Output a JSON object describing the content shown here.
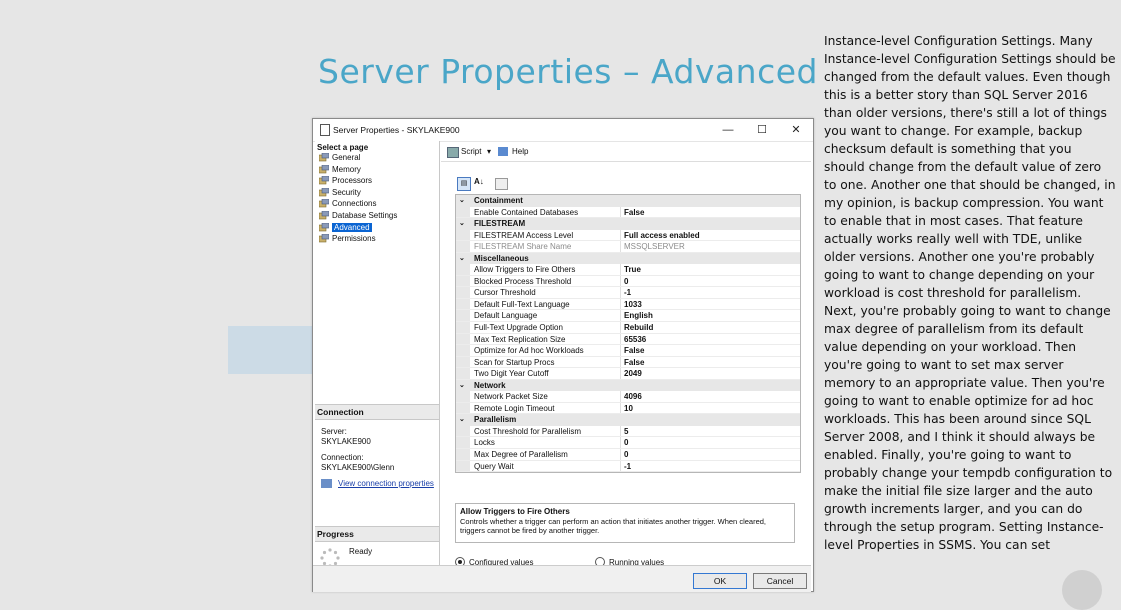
{
  "slide": {
    "title": "Server Properties – Advanced",
    "notes": "Instance-level Configuration Settings. Many Instance-level Configuration Settings should be changed from the default values. Even though this is a better story than SQL Server 2016 than older versions, there's still a lot of things you want to change. For example, backup checksum default is something that you should change from the default value of zero to one. Another one that should be changed, in my opinion, is backup compression. You want to enable that in most cases. That feature actually works really well with TDE, unlike older versions. Another one you're probably going to want to change depending on your workload is cost threshold for parallelism. Next, you're probably going to want to change max degree of parallelism from its default value depending on your workload. Then you're going to want to set max server memory to an appropriate value. Then you're going to want to enable optimize for ad hoc workloads. This has been around since SQL Server 2008, and I think it should always be enabled. Finally, you're going to want to probably change your tempdb configuration to make the initial file size larger and the auto growth increments larger, and you can do through the setup program. Setting Instance-level Properties in SSMS. You can set"
  },
  "dialog": {
    "title": "Server Properties - SKYLAKE900",
    "window_buttons": {
      "minimize": "—",
      "maximize": "☐",
      "close": "✕"
    },
    "select_page_header": "Select a page",
    "pages": [
      "General",
      "Memory",
      "Processors",
      "Security",
      "Connections",
      "Database Settings",
      "Advanced",
      "Permissions"
    ],
    "selected_page": "Advanced",
    "toolbar": {
      "script": "Script",
      "help": "Help"
    },
    "connection": {
      "header": "Connection",
      "server_label": "Server:",
      "server_value": "SKYLAKE900",
      "connection_label": "Connection:",
      "connection_value": "SKYLAKE900\\Glenn",
      "view_link": "View connection properties"
    },
    "progress": {
      "header": "Progress",
      "status": "Ready"
    },
    "grid": [
      {
        "type": "cat",
        "name": "Containment"
      },
      {
        "type": "prop",
        "name": "Enable Contained Databases",
        "value": "False"
      },
      {
        "type": "cat",
        "name": "FILESTREAM"
      },
      {
        "type": "prop",
        "name": "FILESTREAM Access Level",
        "value": "Full access enabled"
      },
      {
        "type": "prop",
        "name": "FILESTREAM Share Name",
        "value": "MSSQLSERVER",
        "disabled": true
      },
      {
        "type": "cat",
        "name": "Miscellaneous"
      },
      {
        "type": "prop",
        "name": "Allow Triggers to Fire Others",
        "value": "True"
      },
      {
        "type": "prop",
        "name": "Blocked Process Threshold",
        "value": "0"
      },
      {
        "type": "prop",
        "name": "Cursor Threshold",
        "value": "-1"
      },
      {
        "type": "prop",
        "name": "Default Full-Text Language",
        "value": "1033"
      },
      {
        "type": "prop",
        "name": "Default Language",
        "value": "English"
      },
      {
        "type": "prop",
        "name": "Full-Text Upgrade Option",
        "value": "Rebuild"
      },
      {
        "type": "prop",
        "name": "Max Text Replication Size",
        "value": "65536"
      },
      {
        "type": "prop",
        "name": "Optimize for Ad hoc Workloads",
        "value": "False"
      },
      {
        "type": "prop",
        "name": "Scan for Startup Procs",
        "value": "False"
      },
      {
        "type": "prop",
        "name": "Two Digit Year Cutoff",
        "value": "2049"
      },
      {
        "type": "cat",
        "name": "Network"
      },
      {
        "type": "prop",
        "name": "Network Packet Size",
        "value": "4096"
      },
      {
        "type": "prop",
        "name": "Remote Login Timeout",
        "value": "10"
      },
      {
        "type": "cat",
        "name": "Parallelism"
      },
      {
        "type": "prop",
        "name": "Cost Threshold for Parallelism",
        "value": "5"
      },
      {
        "type": "prop",
        "name": "Locks",
        "value": "0"
      },
      {
        "type": "prop",
        "name": "Max Degree of Parallelism",
        "value": "0"
      },
      {
        "type": "prop",
        "name": "Query Wait",
        "value": "-1"
      }
    ],
    "description": {
      "title": "Allow Triggers to Fire Others",
      "text": "Controls whether a trigger can perform an action that initiates another trigger. When cleared, triggers cannot be fired by another trigger."
    },
    "radios": {
      "configured": "Configured values",
      "running": "Running values",
      "selected": "configured"
    },
    "buttons": {
      "ok": "OK",
      "cancel": "Cancel"
    }
  }
}
